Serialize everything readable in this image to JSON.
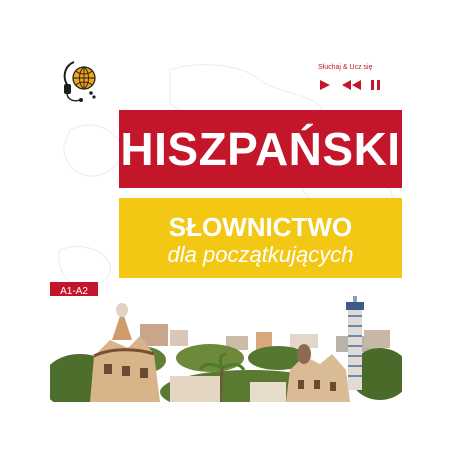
{
  "cover": {
    "title": "HISZPAŃSKI",
    "subtitle_line1": "SŁOWNICTWO",
    "subtitle_line2": "dla początkujących",
    "level": "A1-A2",
    "player_label": "Słuchaj & Ucz się"
  },
  "icons": {
    "logo": "globe-headphones-logo",
    "play": "play-icon",
    "rewind": "rewind-icon",
    "pause": "pause-icon"
  },
  "colors": {
    "title_band": "#c4162b",
    "subtitle_band": "#f2c814",
    "accent": "#c4162b"
  }
}
